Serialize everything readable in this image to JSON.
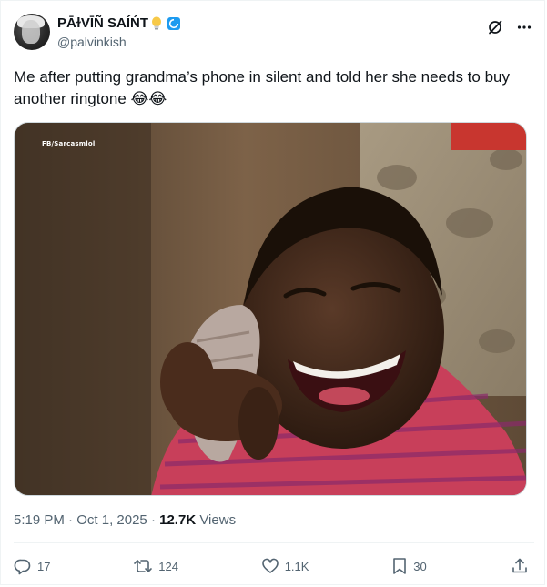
{
  "tweet": {
    "author": {
      "display_name": "PĀɫVĪÑ SAÍŃT",
      "handle": "@palvinkish",
      "verified": true
    },
    "text": "Me after putting grandma’s phone in silent and told her she needs to buy another ringtone 😂😂",
    "media": {
      "watermark": "FB/Sarcasmlol"
    },
    "timestamp": {
      "time": "5:19 PM",
      "separator": "·",
      "date": "Oct 1, 2025",
      "views_count": "12.7K",
      "views_label": "Views"
    },
    "actions": {
      "reply_count": "17",
      "retweet_count": "124",
      "like_count": "1.1K",
      "bookmark_count": "30"
    }
  },
  "icons": {
    "grok": "grok-icon",
    "more": "more-icon",
    "reply": "reply-icon",
    "retweet": "retweet-icon",
    "like": "heart-icon",
    "bookmark": "bookmark-icon",
    "share": "share-icon"
  },
  "colors": {
    "text_primary": "#0f1419",
    "text_secondary": "#536471",
    "verified_blue": "#1d9bf0",
    "border": "#eff3f4"
  }
}
